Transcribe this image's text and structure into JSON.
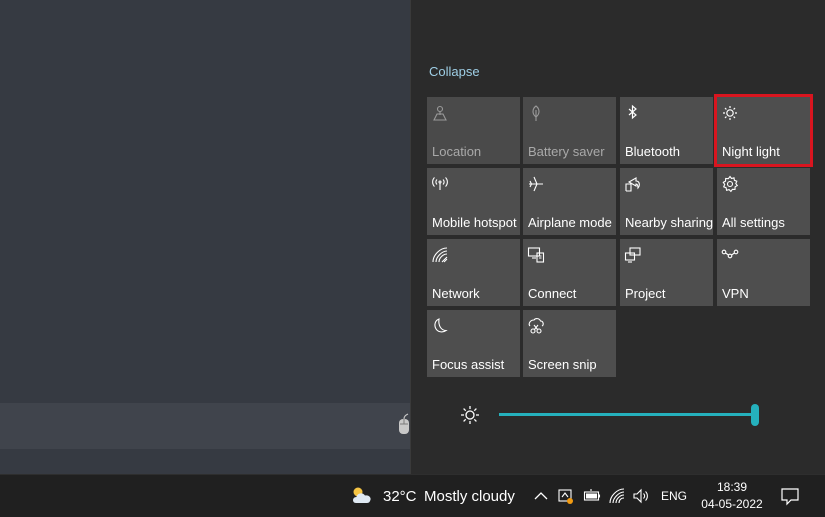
{
  "action_center": {
    "collapse_label": "Collapse",
    "tiles": [
      {
        "label": "Location",
        "icon": "location-icon",
        "enabled": false
      },
      {
        "label": "Battery saver",
        "icon": "battery-saver-icon",
        "enabled": false
      },
      {
        "label": "Bluetooth",
        "icon": "bluetooth-icon",
        "enabled": true
      },
      {
        "label": "Night light",
        "icon": "night-light-icon",
        "enabled": true,
        "highlighted": true
      },
      {
        "label": "Mobile hotspot",
        "icon": "mobile-hotspot-icon",
        "enabled": true
      },
      {
        "label": "Airplane mode",
        "icon": "airplane-icon",
        "enabled": true
      },
      {
        "label": "Nearby sharing",
        "icon": "nearby-sharing-icon",
        "enabled": true
      },
      {
        "label": "All settings",
        "icon": "gear-icon",
        "enabled": true
      },
      {
        "label": "Network",
        "icon": "network-icon",
        "enabled": true
      },
      {
        "label": "Connect",
        "icon": "connect-icon",
        "enabled": true
      },
      {
        "label": "Project",
        "icon": "project-icon",
        "enabled": true
      },
      {
        "label": "VPN",
        "icon": "vpn-icon",
        "enabled": true
      },
      {
        "label": "Focus assist",
        "icon": "moon-icon",
        "enabled": true
      },
      {
        "label": "Screen snip",
        "icon": "screen-snip-icon",
        "enabled": true
      }
    ],
    "brightness_level": 1.0,
    "highlight_color": "#d9151f",
    "accent_color": "#25b1bd"
  },
  "taskbar": {
    "weather_temp": "32°C",
    "weather_condition": "Mostly cloudy",
    "language": "ENG",
    "time": "18:39",
    "date": "04-05-2022"
  }
}
